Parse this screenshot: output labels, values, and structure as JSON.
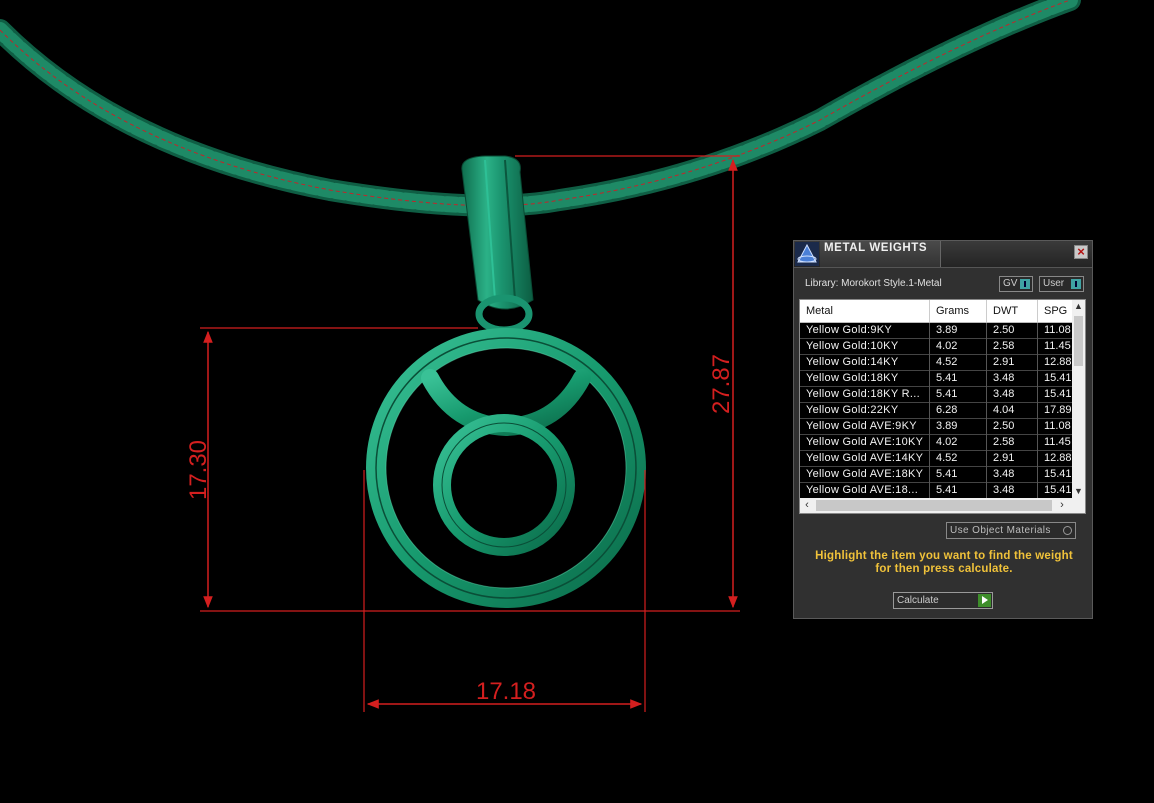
{
  "dimensions": {
    "height_label": "17.30",
    "width_label": "17.18",
    "total_height_label": "27.87"
  },
  "panel": {
    "title": "METAL WEIGHTS",
    "close_icon": "close-icon",
    "library_label": "Library: Morokort Style.1-Metal",
    "toggles": {
      "gv": "GV",
      "user": "User"
    },
    "columns": [
      "Metal",
      "Grams",
      "DWT",
      "SPG"
    ],
    "rows": [
      [
        "Yellow Gold:9KY",
        "3.89",
        "2.50",
        "11.08"
      ],
      [
        "Yellow Gold:10KY",
        "4.02",
        "2.58",
        "11.45"
      ],
      [
        "Yellow Gold:14KY",
        "4.52",
        "2.91",
        "12.88"
      ],
      [
        "Yellow Gold:18KY",
        "5.41",
        "3.48",
        "15.41"
      ],
      [
        "Yellow Gold:18KY R...",
        "5.41",
        "3.48",
        "15.41"
      ],
      [
        "Yellow Gold:22KY",
        "6.28",
        "4.04",
        "17.89"
      ],
      [
        "Yellow Gold AVE:9KY",
        "3.89",
        "2.50",
        "11.08"
      ],
      [
        "Yellow Gold AVE:10KY",
        "4.02",
        "2.58",
        "11.45"
      ],
      [
        "Yellow Gold AVE:14KY",
        "4.52",
        "2.91",
        "12.88"
      ],
      [
        "Yellow Gold AVE:18KY",
        "5.41",
        "3.48",
        "15.41"
      ],
      [
        "Yellow Gold AVE:18...",
        "5.41",
        "3.48",
        "15.41"
      ]
    ],
    "use_object_materials": "Use Object Materials",
    "instructions_line1": "Highlight the item you want to find the weight",
    "instructions_line2": "for then press calculate.",
    "calculate_label": "Calculate"
  },
  "colors": {
    "dimension": "#d41f1f",
    "pendant": "#1f8f6a",
    "instructions": "#f0c23a"
  }
}
